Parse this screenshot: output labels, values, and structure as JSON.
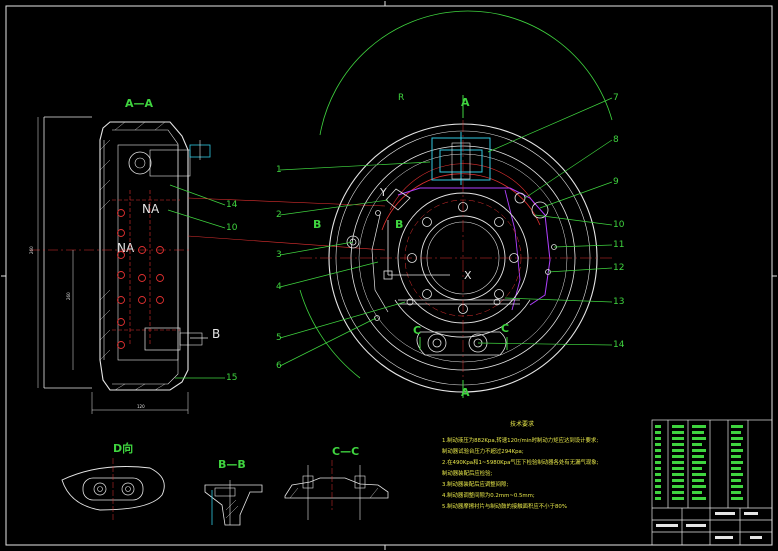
{
  "views": {
    "section_aa": "A—A",
    "marker_a_top": "A",
    "marker_a_bottom": "A",
    "marker_b": "B",
    "marker_b2": "B",
    "marker_c_left": "C",
    "marker_c_right": "C",
    "marker_d": "D",
    "view_d": "D向",
    "section_bb": "B—B",
    "section_cc": "C—C"
  },
  "notes": {
    "title": "技术要求",
    "lines": [
      "1.制动液压为882Kpa,转速120r/min时制动力矩应达到设计要求;",
      "制动器试验台压力不超过294Kpa;",
      "2.在490Kpa和1~5980Kpa气压下检验制动器各处有无漏气现象;",
      "制动器装配后应检验;",
      "3.制动器装配后应调整间隙;",
      "4.制动器调整间隙为0.2mm~0.5mm;",
      "5.制动器摩擦衬片与制动鼓的接触面积应不小于80%"
    ]
  },
  "colors": {
    "background": "#000000",
    "outline": "#e6e6e6",
    "leader": "#3fd43f",
    "hidden": "#d0307a",
    "purple": "#b040ff",
    "cyan": "#30c8e0",
    "center": "#e03030"
  }
}
